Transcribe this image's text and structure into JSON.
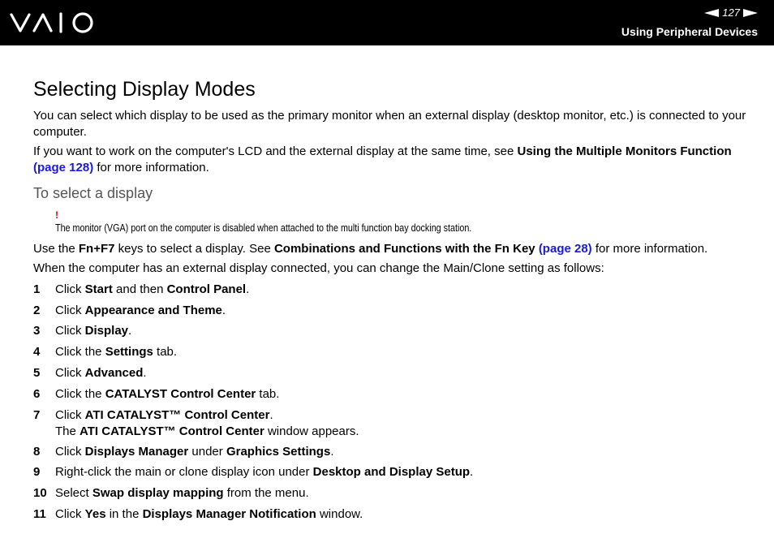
{
  "header": {
    "logo_text": "VAIO",
    "page_number": "127",
    "section_title": "Using Peripheral Devices"
  },
  "title": "Selecting Display Modes",
  "intro": "You can select which display to be used as the primary monitor when an external display (desktop monitor, etc.) is connected to your computer.",
  "multi": {
    "pre": "If you want to work on the computer's LCD and the external display at the same time, see ",
    "bold": "Using the Multiple Monitors Function",
    "link": "(page 128)",
    "post": " for more information."
  },
  "subhead": "To select a display",
  "warning": {
    "mark": "!",
    "text": "The monitor (VGA) port on the computer is disabled when attached to the multi function bay docking station."
  },
  "fn": {
    "pre": "Use the ",
    "keys": "Fn+F7",
    "mid": " keys to select a display. See ",
    "bold": "Combinations and Functions with the Fn Key",
    "link": "(page 28)",
    "post": " for more information."
  },
  "clone_intro": "When the computer has an external display connected, you can change the Main/Clone setting as follows:",
  "steps": [
    {
      "num": "1",
      "a": "Click ",
      "b": "Start",
      "c": " and then ",
      "d": "Control Panel",
      "e": "."
    },
    {
      "num": "2",
      "a": "Click ",
      "b": "Appearance and Theme",
      "c": "."
    },
    {
      "num": "3",
      "a": "Click ",
      "b": "Display",
      "c": "."
    },
    {
      "num": "4",
      "a": "Click the ",
      "b": "Settings",
      "c": " tab."
    },
    {
      "num": "5",
      "a": "Click ",
      "b": "Advanced",
      "c": "."
    },
    {
      "num": "6",
      "a": "Click the ",
      "b": "CATALYST Control Center",
      "c": " tab."
    },
    {
      "num": "7",
      "a": "Click ",
      "b": "ATI CATALYST™ Control Center",
      "c": ".",
      "l2a": "The ",
      "l2b": "ATI CATALYST™ Control Center",
      "l2c": " window appears."
    },
    {
      "num": "8",
      "a": "Click ",
      "b": "Displays Manager",
      "c": " under ",
      "d": "Graphics Settings",
      "e": "."
    },
    {
      "num": "9",
      "a": "Right-click the main or clone display icon under ",
      "b": "Desktop and Display Setup",
      "c": "."
    },
    {
      "num": "10",
      "a": "Select ",
      "b": "Swap display mapping",
      "c": " from the menu."
    },
    {
      "num": "11",
      "a": "Click ",
      "b": "Yes",
      "c": " in the ",
      "d": "Displays Manager Notification",
      "e": " window."
    }
  ]
}
